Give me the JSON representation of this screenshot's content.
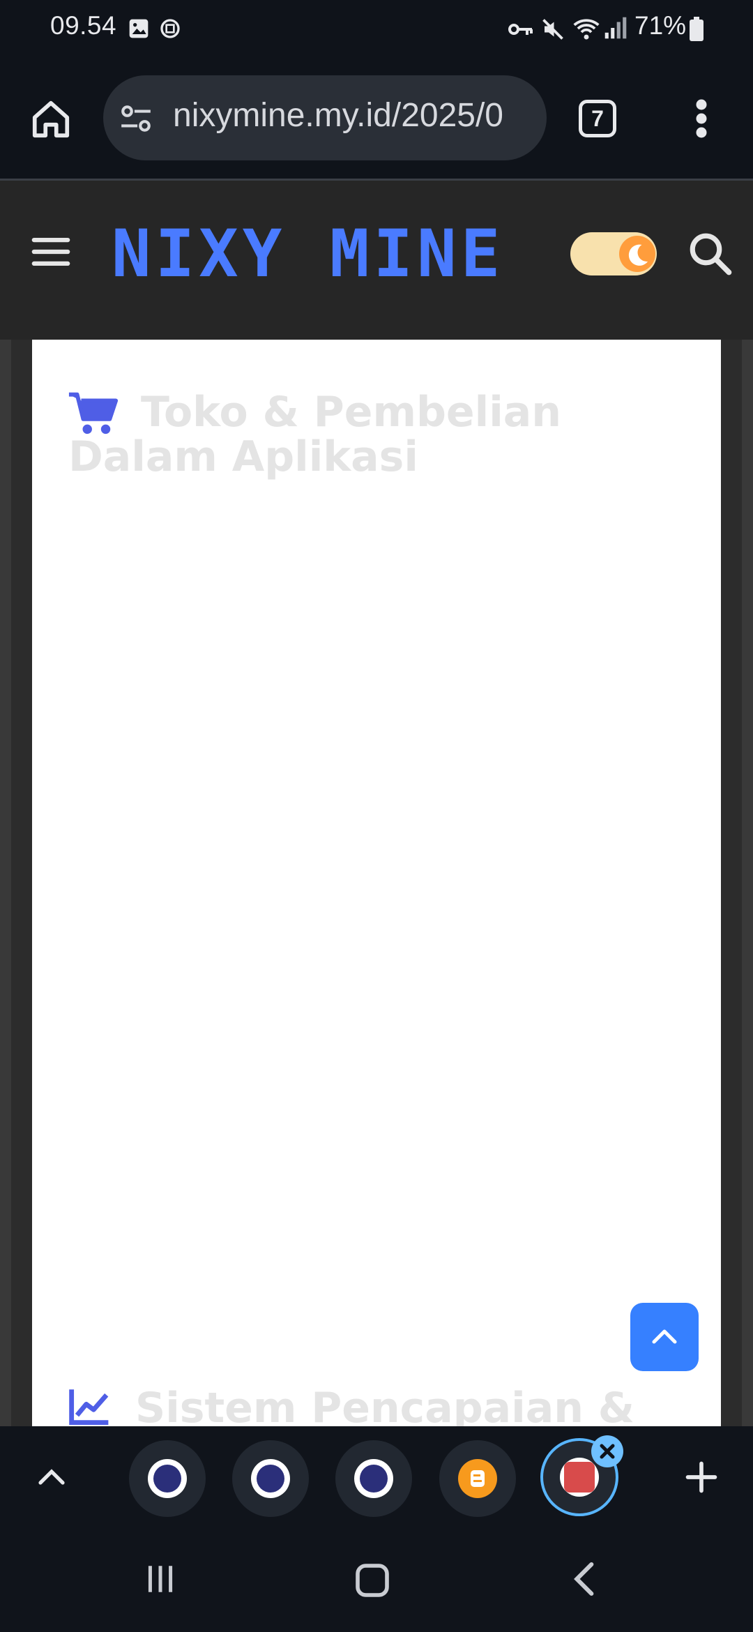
{
  "status_bar": {
    "time": "09.54",
    "battery_percent": "71%",
    "icons": [
      "gallery-icon",
      "app-icon",
      "vpn-key-icon",
      "mute-icon",
      "wifi-icon",
      "signal-icon",
      "battery-icon"
    ]
  },
  "browser": {
    "url": "nixymine.my.id/2025/0",
    "tab_count": "7"
  },
  "site": {
    "logo": "NIXY MINE",
    "accent_color": "#4a7bff",
    "dark_mode_toggle": "on"
  },
  "content": {
    "section1_title_line1": "Toko & Pembelian",
    "section1_title_line2": "Dalam Aplikasi",
    "section2_title": "Sistem Pencapaian &"
  },
  "tab_strip": {
    "tabs": [
      "nixy-tab-1",
      "nixy-tab-2",
      "nixy-tab-3",
      "blogger-tab",
      "nixymine-tab-active"
    ]
  }
}
